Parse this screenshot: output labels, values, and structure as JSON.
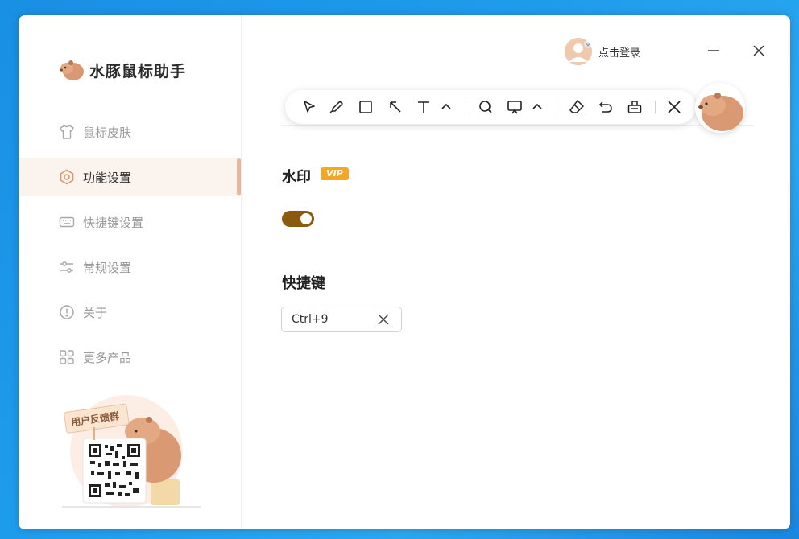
{
  "app": {
    "title": "水豚鼠标助手"
  },
  "sidebar": {
    "items": [
      {
        "label": "鼠标皮肤",
        "icon": "shirt-icon",
        "active": false
      },
      {
        "label": "功能设置",
        "icon": "hexagon-settings-icon",
        "active": true
      },
      {
        "label": "快捷键设置",
        "icon": "keyboard-icon",
        "active": false
      },
      {
        "label": "常规设置",
        "icon": "sliders-icon",
        "active": false
      },
      {
        "label": "关于",
        "icon": "info-circle-icon",
        "active": false
      },
      {
        "label": "更多产品",
        "icon": "grid-icon",
        "active": false
      }
    ],
    "feedback": {
      "sign_text": "用户反馈群"
    }
  },
  "header": {
    "login_label": "点击登录"
  },
  "toolbar": {
    "tools": [
      "pointer-icon",
      "pen-icon",
      "rectangle-icon",
      "arrow-icon",
      "text-icon",
      "chevron-up-icon",
      "magnifier-icon",
      "screen-icon",
      "chevron-up-icon",
      "eraser-icon",
      "undo-icon",
      "clear-icon",
      "close-icon"
    ]
  },
  "settings": {
    "watermark": {
      "title": "水印",
      "badge": "VIP",
      "enabled": true
    },
    "hotkey": {
      "title": "快捷键",
      "value": "Ctrl+9"
    }
  },
  "colors": {
    "accent": "#e9b59a",
    "toggle_on": "#8a5a0f",
    "vip": "#f5a623"
  }
}
